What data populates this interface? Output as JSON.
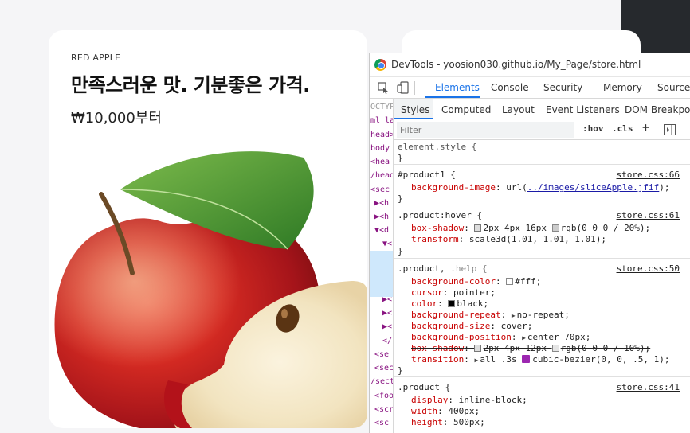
{
  "product_card": {
    "eyebrow": "RED APPLE",
    "headline": "만족스러운 맛. 기분좋은 가격.",
    "price": "₩10,000부터"
  },
  "devtools": {
    "window_title": "DevTools - yoosion030.github.io/My_Page/store.html",
    "main_tabs": [
      "Elements",
      "Console",
      "Security",
      "Memory",
      "Sources"
    ],
    "active_main_tab": "Elements",
    "sub_tabs": [
      "Styles",
      "Computed",
      "Layout",
      "Event Listeners",
      "DOM Breakpoints"
    ],
    "active_sub_tab": "Styles",
    "filter_placeholder": "Filter",
    "hov_label": ":hov",
    "cls_label": ".cls",
    "plus_label": "+",
    "tree_lines": [
      "OCTYP",
      "ml la",
      "head>",
      "body c",
      "<hea",
      "/head",
      "<sec",
      "▶<h",
      "▶<h",
      "▼<d",
      "▼<",
      "",
      "",
      "▶<",
      "▶<",
      "▶<",
      "</",
      "<se",
      "<sec",
      "/sect",
      "<foo",
      "<scr",
      "<sc"
    ],
    "rules": [
      {
        "selector": "element.style {",
        "close": "}"
      },
      {
        "selector": "#product1 {",
        "source": "store.css:66",
        "prop": "background-image",
        "val_pre": "url(",
        "link": "../images/sliceApple.jfif",
        "val_post": ");",
        "close": "}"
      },
      {
        "selector": ".product:hover {",
        "source": "store.css:61",
        "p1": "box-shadow",
        "v1a": "2px 4px 16px",
        "v1b": "rgb(0 0 0 / 20%);",
        "p2": "transform",
        "v2": "scale3d(1.01, 1.01, 1.01);",
        "close": "}"
      },
      {
        "selector_a": ".product,",
        "selector_b": ".help {",
        "source": "store.css:50",
        "props": [
          {
            "p": "background-color",
            "v": "#fff;"
          },
          {
            "p": "cursor",
            "v": "pointer;"
          },
          {
            "p": "color",
            "v": "black;"
          },
          {
            "p": "background-repeat",
            "v": "no-repeat;"
          },
          {
            "p": "background-size",
            "v": "cover;"
          },
          {
            "p": "background-position",
            "v": "center 70px;"
          },
          {
            "p": "box-shadow",
            "v": "2px 4px 12px",
            "v2": "rgb(0 0 0 / 10%);"
          },
          {
            "p": "transition",
            "v": "all .3s",
            "v2": "cubic-bezier(0, 0, .5, 1);"
          }
        ],
        "close": "}"
      },
      {
        "selector": ".product {",
        "source": "store.css:41",
        "props": [
          {
            "p": "display",
            "v": "inline-block;"
          },
          {
            "p": "width",
            "v": "400px;"
          },
          {
            "p": "height",
            "v": "500px;"
          }
        ]
      }
    ]
  },
  "colors": {
    "accent": "#1a73e8",
    "property": "#c80000",
    "selected_node": "#cfe8fc",
    "dark_strip": "#26292d"
  }
}
